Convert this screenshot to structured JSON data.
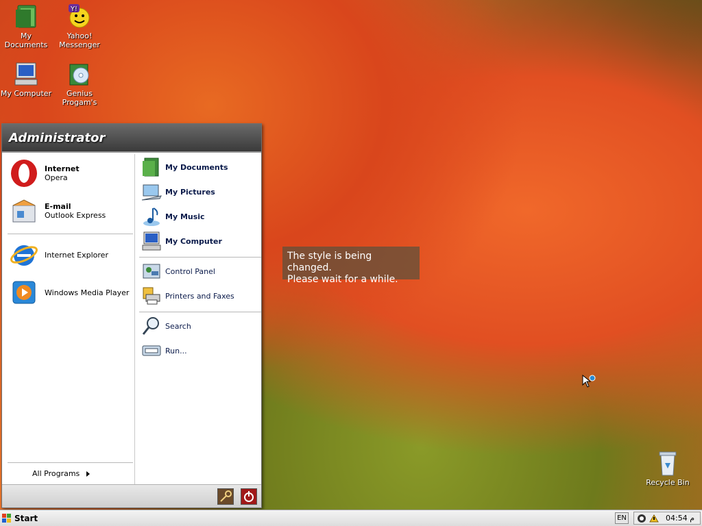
{
  "desktop_icons": [
    {
      "name": "documents",
      "label": "My Documents"
    },
    {
      "name": "yahoo",
      "label": "Yahoo! Messenger"
    },
    {
      "name": "computer",
      "label": "My Computer"
    },
    {
      "name": "genius",
      "label": "Genius Progam's"
    },
    {
      "name": "recycle",
      "label": "Recycle Bin"
    }
  ],
  "start_menu": {
    "user": "Administrator",
    "pinned": [
      {
        "title": "Internet",
        "subtitle": "Opera"
      },
      {
        "title": "E-mail",
        "subtitle": "Outlook Express"
      }
    ],
    "recent": [
      {
        "label": "Internet Explorer"
      },
      {
        "label": "Windows Media Player"
      }
    ],
    "all_programs": "All Programs",
    "places": [
      {
        "label": "My Documents"
      },
      {
        "label": "My Pictures"
      },
      {
        "label": "My Music"
      },
      {
        "label": "My Computer"
      }
    ],
    "settings": [
      {
        "label": "Control Panel"
      },
      {
        "label": "Printers and Faxes"
      }
    ],
    "tools": [
      {
        "label": "Search"
      },
      {
        "label": "Run..."
      }
    ]
  },
  "tooltip": {
    "line1": "The style is being changed.",
    "line2": "Please wait for a while."
  },
  "taskbar": {
    "start_label": "Start",
    "language": "EN",
    "clock": "04:54 ﻡ"
  },
  "colors": {
    "accent_header": "#4a4a4a",
    "menu_text": "#0a1a4a"
  }
}
